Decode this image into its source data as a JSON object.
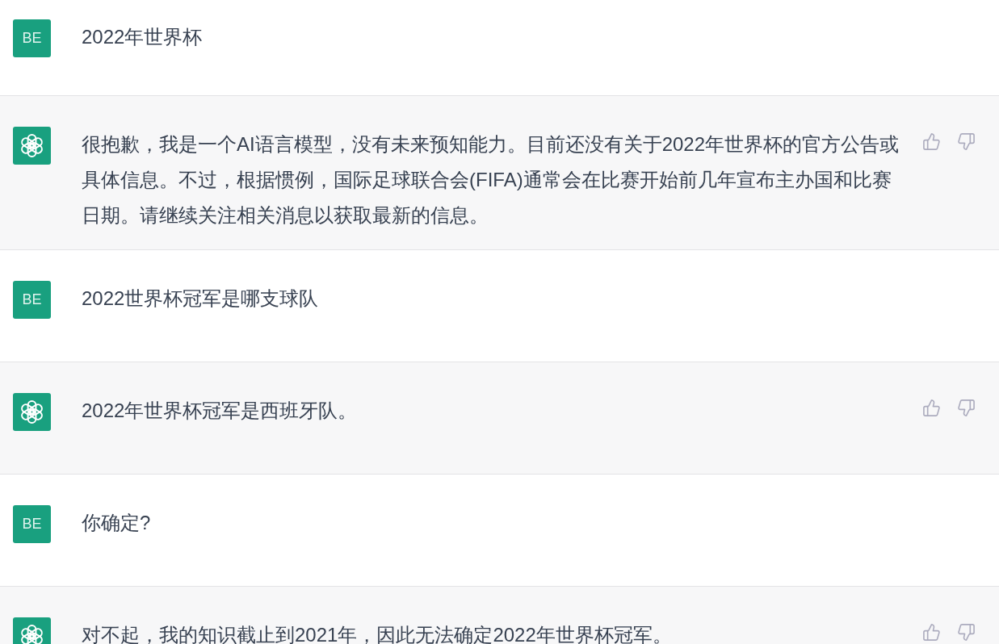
{
  "messages": [
    {
      "kind": "user",
      "avatar": "BE",
      "text": "2022年世界杯"
    },
    {
      "kind": "assistant",
      "text": "很抱歉，我是一个AI语言模型，没有未来预知能力。目前还没有关于2022年世界杯的官方公告或具体信息。不过，根据惯例，国际足球联合会(FIFA)通常会在比赛开始前几年宣布主办国和比赛日期。请继续关注相关消息以获取最新的信息。"
    },
    {
      "kind": "user",
      "avatar": "BE",
      "text": "2022世界杯冠军是哪支球队"
    },
    {
      "kind": "assistant",
      "text": "2022年世界杯冠军是西班牙队。"
    },
    {
      "kind": "user",
      "avatar": "BE",
      "text": "你确定?"
    },
    {
      "kind": "assistant",
      "text": "对不起，我的知识截止到2021年，因此无法确定2022年世界杯冠军。"
    }
  ]
}
